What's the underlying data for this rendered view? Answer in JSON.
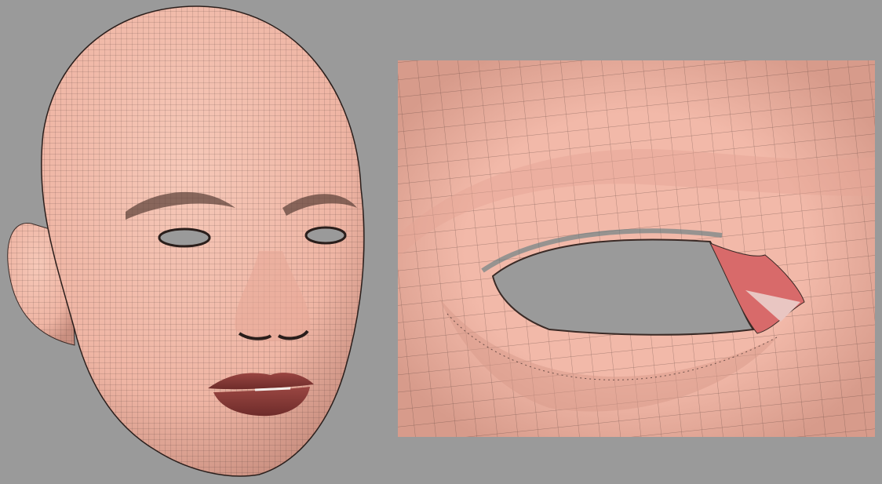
{
  "colors": {
    "background": "#9a9a9a",
    "skin": "#f0b8a8",
    "skin_shadow": "#d89a8a",
    "mesh_line": "#4a3530",
    "lips": "#8a3a38",
    "eye_hole": "#9a9a9a",
    "inner_corner": "#d86a6a"
  }
}
